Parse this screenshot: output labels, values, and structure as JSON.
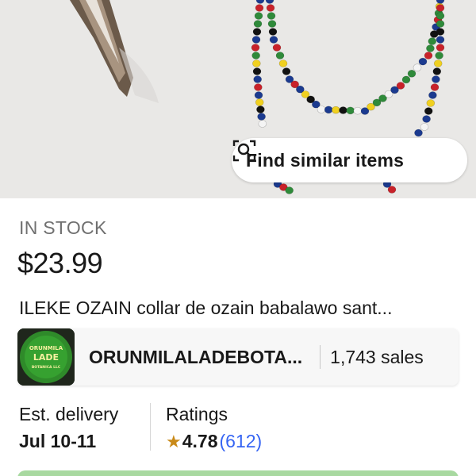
{
  "hero": {
    "find_similar_label": "Find similar items",
    "find_similar_icon": "image-search-icon"
  },
  "listing": {
    "stock_status": "IN STOCK",
    "price": "$23.99",
    "title": "ILEKE OZAIN collar de ozain babalawo sant..."
  },
  "seller": {
    "logo_text_top": "ORUNMILA",
    "logo_text_mid": "LADE",
    "logo_text_bottom": "BOTANICA LLC",
    "name": "ORUNMILALADEBOTA...",
    "sales": "1,743 sales"
  },
  "delivery": {
    "label": "Est. delivery",
    "value": "Jul 10-11"
  },
  "ratings": {
    "label": "Ratings",
    "star": "★",
    "score": "4.78",
    "count": "(612)"
  },
  "colors": {
    "link_blue": "#3665f3",
    "star_gold": "#c98a19",
    "buy_bar_green": "#a8d9a0"
  }
}
